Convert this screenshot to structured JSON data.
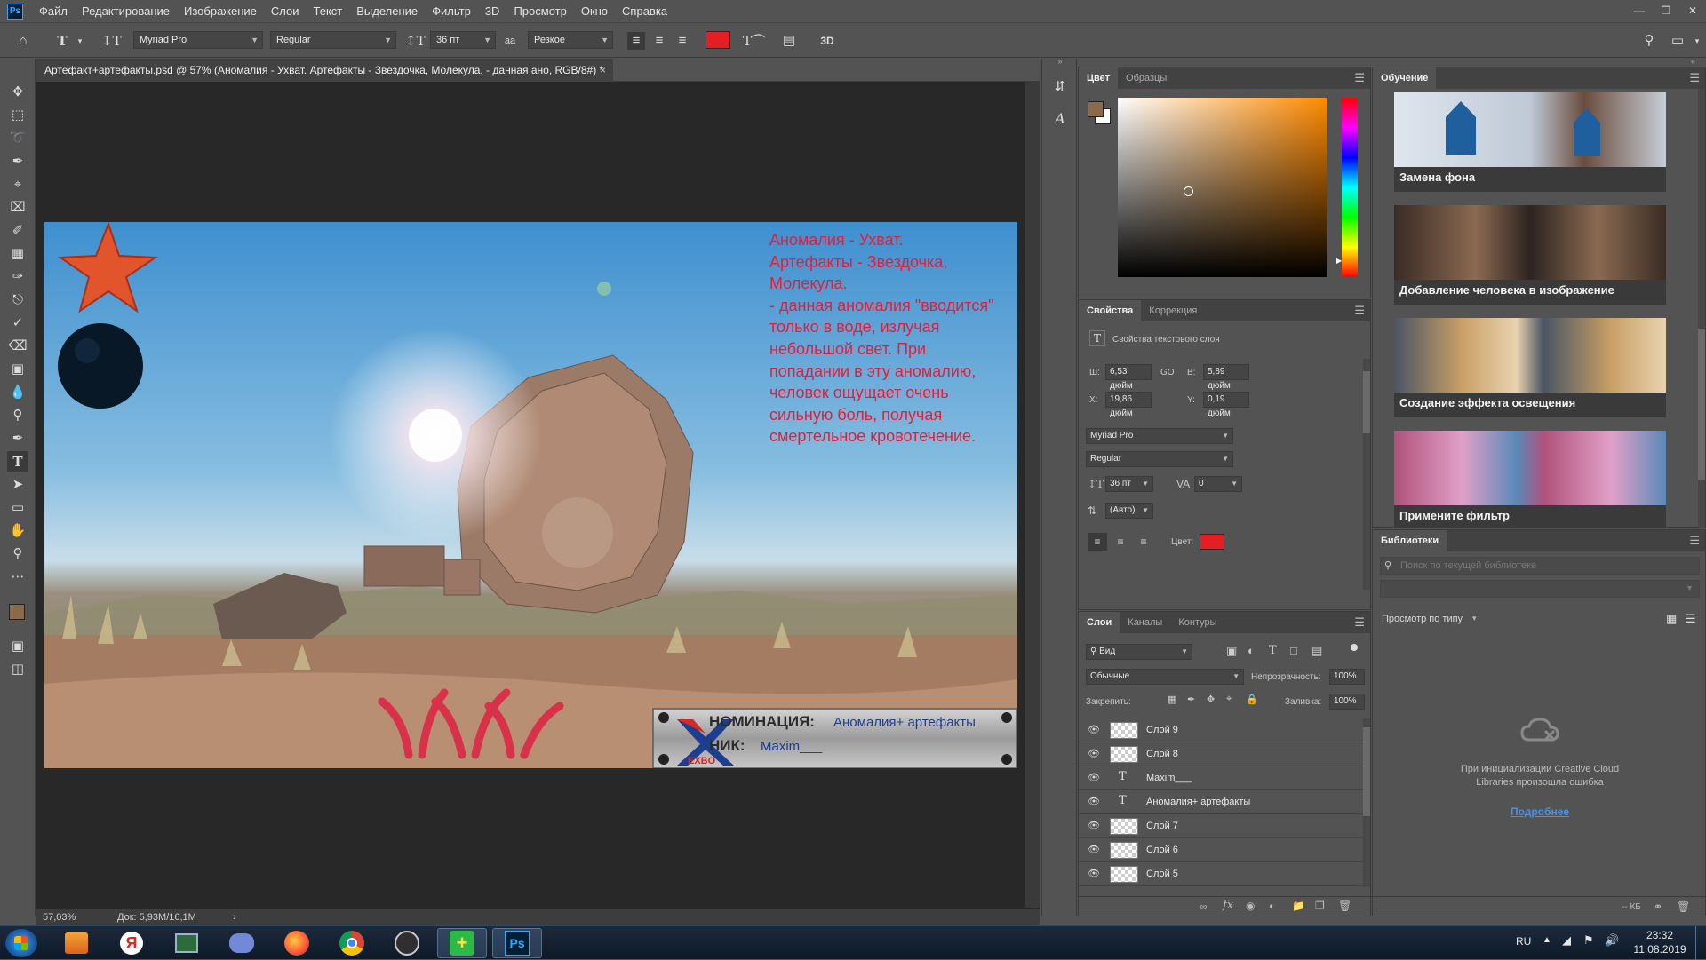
{
  "menubar": {
    "logo": "Ps",
    "items": [
      "Файл",
      "Редактирование",
      "Изображение",
      "Слои",
      "Текст",
      "Выделение",
      "Фильтр",
      "3D",
      "Просмотр",
      "Окно",
      "Справка"
    ]
  },
  "options": {
    "font_family": "Myriad Pro",
    "font_style": "Regular",
    "font_size": "36 пт",
    "antialias": "Резкое",
    "text_color": "#e31e24",
    "label_3d": "3D"
  },
  "document": {
    "tab_title": "Артефакт+артефакты.psd @ 57% (Аномалия - Ухват. Артефакты - Звездочка, Молекула. - данная ано, RGB/8#) *",
    "tab_close": "×",
    "zoom": "57,03%",
    "doc_size": "Док: 5,93M/16,1M",
    "canvas_text_lines": [
      "Аномалия - Ухват.",
      "Артефакты - Звездочка,",
      "Молекула.",
      "- данная аномалия \"вводится\"",
      "только в воде, излучая",
      "небольшой свет. При",
      "попадании в эту аномалию,",
      "человек ощущает очень",
      "сильную боль, получая",
      "смертельное кровотечение."
    ],
    "nomination_label": "НОМИНАЦИЯ:",
    "nomination_value": "Аномалия+ артефакты",
    "nick_label": "НИК:",
    "nick_value": "Maxim___",
    "exbo_logo": "EXBO"
  },
  "color_panel": {
    "tabs": [
      "Цвет",
      "Образцы"
    ],
    "fg_color": "#8b6a4b",
    "bg_color": "#ffffff"
  },
  "properties": {
    "tabs": [
      "Свойства",
      "Коррекция"
    ],
    "title": "Свойства текстового слоя",
    "w_label": "Ш:",
    "w_value": "6,53 дюйм",
    "link_label": "GO",
    "h_label": "В:",
    "h_value": "5,89 дюйм",
    "x_label": "X:",
    "x_value": "19,86 дюйм",
    "y_label": "Y:",
    "y_value": "0,19 дюйм",
    "font_family": "Myriad Pro",
    "font_style": "Regular",
    "font_size": "36 пт",
    "tracking": "0",
    "leading": "(Авто)",
    "color_label": "Цвет:",
    "color": "#e31e24"
  },
  "layers": {
    "tabs": [
      "Слои",
      "Каналы",
      "Контуры"
    ],
    "filter_label": "Вид",
    "blend_mode": "Обычные",
    "opacity_label": "Непрозрачность:",
    "opacity": "100%",
    "lock_label": "Закрепить:",
    "fill_label": "Заливка:",
    "fill": "100%",
    "items": [
      {
        "name": "Слой 9",
        "type": "raster"
      },
      {
        "name": "Слой 8",
        "type": "raster"
      },
      {
        "name": "Maxim___",
        "type": "text"
      },
      {
        "name": "Аномалия+ артефакты",
        "type": "text"
      },
      {
        "name": "Слой 7",
        "type": "raster"
      },
      {
        "name": "Слой 6",
        "type": "raster"
      },
      {
        "name": "Слой 5",
        "type": "raster"
      }
    ]
  },
  "learn": {
    "tab": "Обучение",
    "cards": [
      "Замена фона",
      "Добавление человека в изображение",
      "Создание эффекта освещения",
      "Примените фильтр"
    ]
  },
  "libraries": {
    "tab": "Библиотеки",
    "search_placeholder": "Поиск по текущей библиотеке",
    "view_label": "Просмотр по типу",
    "error_line1": "При инициализации Creative Cloud",
    "error_line2": "Libraries произошла ошибка",
    "more_link": "Подробнее",
    "size_label": "-- КБ"
  },
  "taskbar": {
    "lang": "RU",
    "time": "23:32",
    "date": "11.08.2019",
    "ps_label": "Ps"
  }
}
